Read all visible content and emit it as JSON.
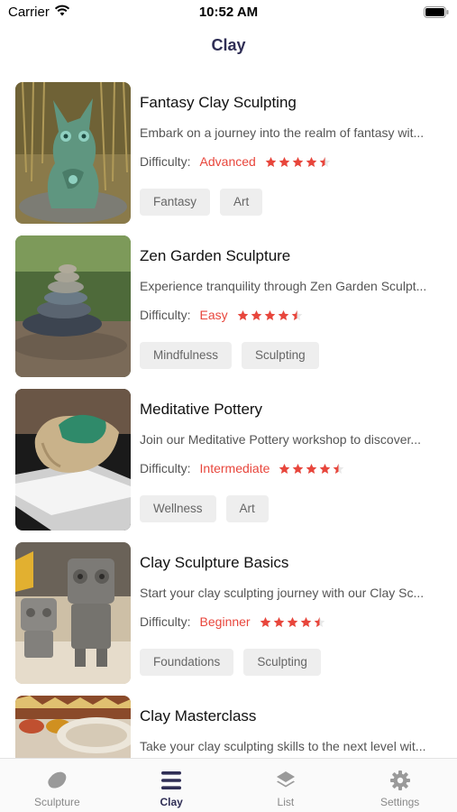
{
  "status_bar": {
    "carrier": "Carrier",
    "time": "10:52 AM"
  },
  "nav": {
    "title": "Clay"
  },
  "labels": {
    "difficulty": "Difficulty:"
  },
  "colors": {
    "accent": "#e8463c",
    "title": "#2f2e55",
    "tag_bg": "#eeeeee"
  },
  "items": [
    {
      "title": "Fantasy Clay Sculpting",
      "description": "Embark on a journey into the realm of fantasy wit...",
      "difficulty": "Advanced",
      "rating": 4.5,
      "tags": [
        "Fantasy",
        "Art"
      ]
    },
    {
      "title": "Zen Garden Sculpture",
      "description": "Experience tranquility through Zen Garden Sculpt...",
      "difficulty": "Easy",
      "rating": 4.5,
      "tags": [
        "Mindfulness",
        "Sculpting"
      ]
    },
    {
      "title": "Meditative Pottery",
      "description": "Join our Meditative Pottery workshop to discover...",
      "difficulty": "Intermediate",
      "rating": 4.5,
      "tags": [
        "Wellness",
        "Art"
      ]
    },
    {
      "title": "Clay Sculpture Basics",
      "description": "Start your clay sculpting journey with our Clay Sc...",
      "difficulty": "Beginner",
      "rating": 4.5,
      "tags": [
        "Foundations",
        "Sculpting"
      ]
    },
    {
      "title": "Clay Masterclass",
      "description": "Take your clay sculpting skills to the next level wit...",
      "difficulty": "",
      "rating": null,
      "tags": []
    }
  ],
  "tabs": [
    {
      "label": "Sculpture",
      "icon": "clay-blob-icon",
      "active": false
    },
    {
      "label": "Clay",
      "icon": "menu-lines-icon",
      "active": true
    },
    {
      "label": "List",
      "icon": "layers-icon",
      "active": false
    },
    {
      "label": "Settings",
      "icon": "gear-icon",
      "active": false
    }
  ]
}
